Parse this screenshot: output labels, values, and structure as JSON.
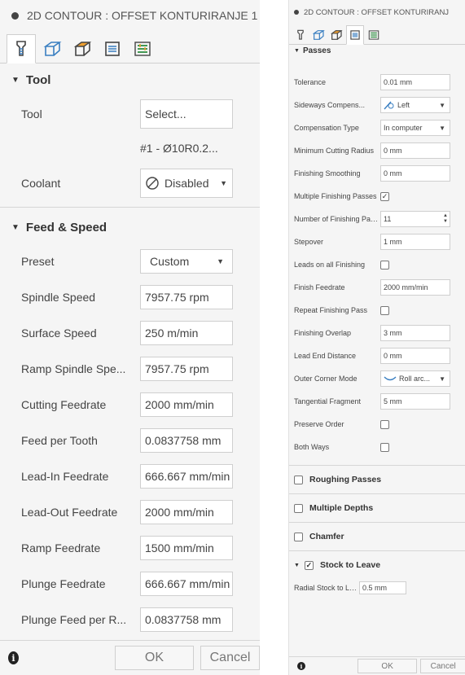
{
  "left_panel": {
    "title": "2D CONTOUR : OFFSET KONTURIRANJE 1",
    "tool_section": {
      "heading": "Tool",
      "tool_label": "Tool",
      "tool_button": "Select...",
      "tool_name": "#1 - Ø10R0.2...",
      "coolant_label": "Coolant",
      "coolant_value": "Disabled"
    },
    "feed_section": {
      "heading": "Feed & Speed",
      "preset_label": "Preset",
      "preset_value": "Custom",
      "rows": [
        {
          "label": "Spindle Speed",
          "value": "7957.75 rpm"
        },
        {
          "label": "Surface Speed",
          "value": "250 m/min"
        },
        {
          "label": "Ramp Spindle Spe...",
          "value": "7957.75 rpm"
        },
        {
          "label": "Cutting Feedrate",
          "value": "2000 mm/min"
        },
        {
          "label": "Feed per Tooth",
          "value": "0.0837758 mm"
        },
        {
          "label": "Lead-In Feedrate",
          "value": "666.667 mm/min"
        },
        {
          "label": "Lead-Out Feedrate",
          "value": "2000 mm/min"
        },
        {
          "label": "Ramp Feedrate",
          "value": "1500 mm/min"
        },
        {
          "label": "Plunge Feedrate",
          "value": "666.667 mm/min"
        },
        {
          "label": "Plunge Feed per R...",
          "value": "0.0837758 mm"
        }
      ]
    },
    "footer": {
      "ok": "OK",
      "cancel": "Cancel"
    }
  },
  "right_panel": {
    "title": "2D CONTOUR : OFFSET KONTURIRANJ",
    "passes_heading": "Passes",
    "rows": {
      "tolerance": {
        "label": "Tolerance",
        "value": "0.01 mm"
      },
      "sideways_comp": {
        "label": "Sideways Compens...",
        "value": "Left"
      },
      "comp_type": {
        "label": "Compensation Type",
        "value": "In computer"
      },
      "min_cut_radius": {
        "label": "Minimum Cutting Radius",
        "value": "0 mm"
      },
      "finishing_smoothing": {
        "label": "Finishing Smoothing",
        "value": "0 mm"
      },
      "multiple_finishing": {
        "label": "Multiple Finishing Passes",
        "checked": true
      },
      "num_finishing": {
        "label": "Number of Finishing Passes",
        "value": "11"
      },
      "stepover": {
        "label": "Stepover",
        "value": "1 mm"
      },
      "leads_all_finishing": {
        "label": "Leads on all Finishing",
        "checked": false
      },
      "finish_feedrate": {
        "label": "Finish Feedrate",
        "value": "2000 mm/min"
      },
      "repeat_finishing": {
        "label": "Repeat Finishing Pass",
        "checked": false
      },
      "finishing_overlap": {
        "label": "Finishing Overlap",
        "value": "3 mm"
      },
      "lead_end_distance": {
        "label": "Lead End Distance",
        "value": "0 mm"
      },
      "outer_corner_mode": {
        "label": "Outer Corner Mode",
        "value": "Roll arc..."
      },
      "tangential_fragment": {
        "label": "Tangential Fragment",
        "value": "5 mm"
      },
      "preserve_order": {
        "label": "Preserve Order",
        "checked": false
      },
      "both_ways": {
        "label": "Both Ways",
        "checked": false
      }
    },
    "sections": {
      "roughing": "Roughing Passes",
      "multiple_depths": "Multiple Depths",
      "chamfer": "Chamfer",
      "stock_to_leave": "Stock to Leave"
    },
    "radial_stock": {
      "label": "Radial Stock to Leave",
      "value": "0.5 mm"
    },
    "footer": {
      "ok": "OK",
      "cancel": "Cancel"
    }
  },
  "colors": {
    "panel_bg": "#f5f5f5",
    "border": "#cfcfcf",
    "tool_tab_accent": "#3a7fc1",
    "setup_tab_accent": "#f0a030",
    "passes_tab_accent": "#2b8a3e"
  }
}
